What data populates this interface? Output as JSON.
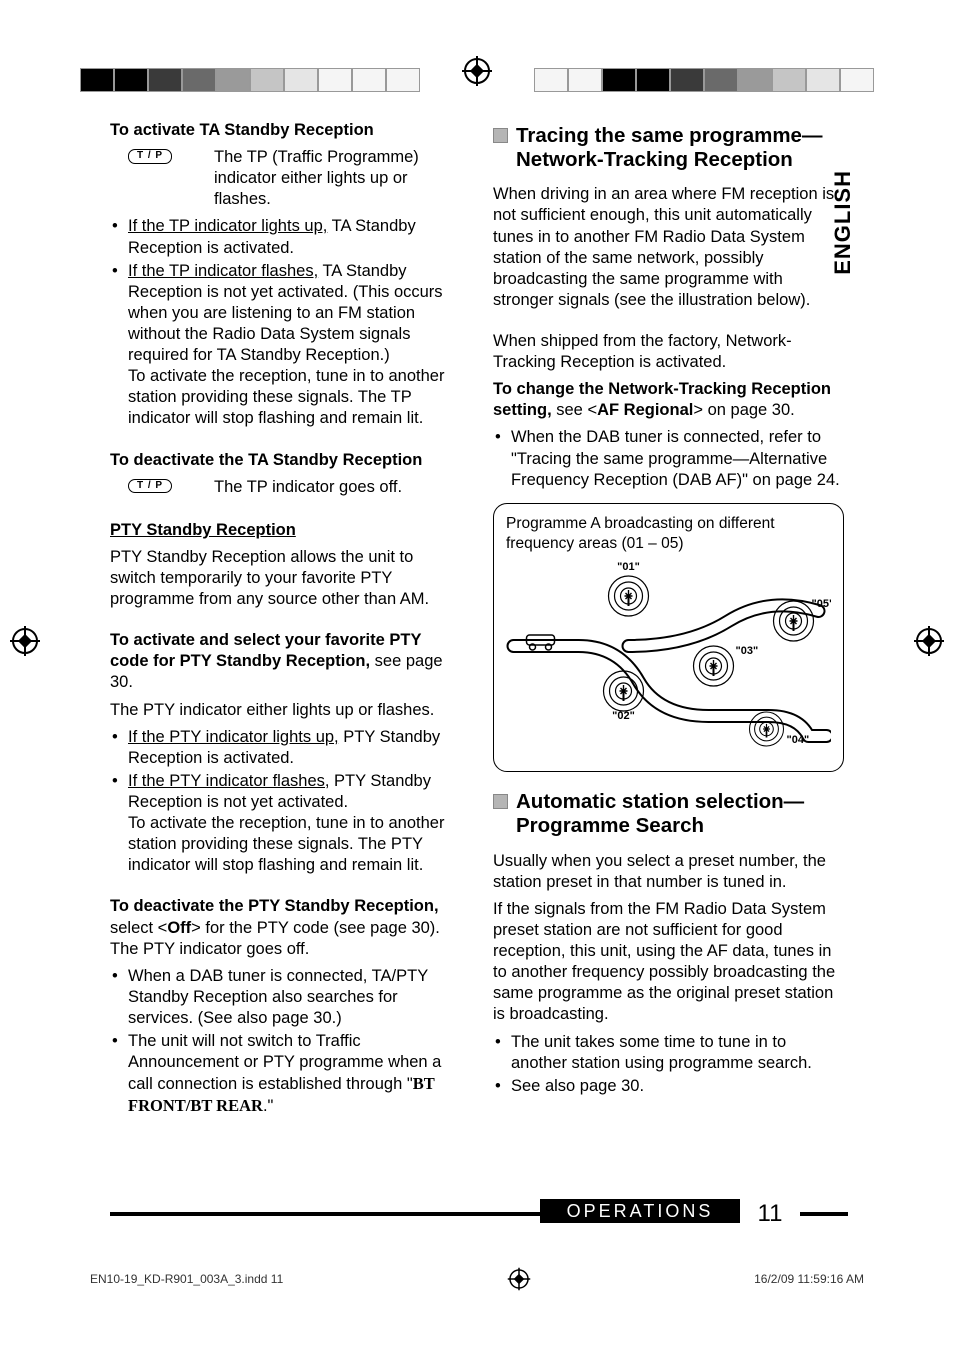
{
  "lang_tab": "ENGLISH",
  "left": {
    "h_activate_ta": "To activate TA Standby Reception",
    "tp_btn": "T / P",
    "tp_desc": "The TP (Traffic Programme) indicator either lights up or flashes.",
    "ta_b1_u": "If the TP indicator lights up,",
    "ta_b1_rest": " TA Standby Reception is activated.",
    "ta_b2_u": "If the TP indicator flashes,",
    "ta_b2_rest": " TA Standby Reception is not yet activated. (This occurs when you are listening to an FM station without the Radio Data System signals required for TA Standby Reception.)",
    "ta_b2_p2": "To activate the reception, tune in to another station providing these signals. The TP indicator will stop flashing and remain lit.",
    "h_deact_ta": "To deactivate the TA Standby Reception",
    "deact_ta_desc": "The TP indicator goes off.",
    "h_pty": "PTY Standby Reception",
    "pty_intro": "PTY Standby Reception allows the unit to switch temporarily to your favorite PTY programme from any source other than AM.",
    "h_act_pty_1": "To activate and select your favorite PTY code for PTY Standby Reception,",
    "h_act_pty_2": " see page 30.",
    "pty_flash": "The PTY indicator either lights up or flashes.",
    "pty_b1_u": "If the PTY indicator lights up,",
    "pty_b1_rest": " PTY Standby Reception is activated.",
    "pty_b2_u": "If the PTY indicator flashes,",
    "pty_b2_rest": " PTY Standby Reception is not yet activated.",
    "pty_b2_p2": "To activate the reception, tune in to another station providing these signals. The PTY indicator will stop flashing and remain lit.",
    "h_deact_pty": "To deactivate the PTY Standby Reception,",
    "deact_pty_rest1": " select <",
    "off_bold": "Off",
    "deact_pty_rest2": "> for the PTY code (see page 30). The PTY indicator goes off.",
    "deact_b1": "When a DAB tuner is connected, TA/PTY Standby Reception also searches for services. (See also page 30.)",
    "deact_b2_a": "The unit will not switch to Traffic Announcement or PTY programme when a call connection is established through \"",
    "bt_bold": "BT FRONT/BT REAR",
    "deact_b2_b": ".\""
  },
  "right": {
    "sec1_title": "Tracing the same programme—Network-Tracking Reception",
    "sec1_p1": "When driving in an area where FM reception is not sufficient enough, this unit automatically tunes in to another FM Radio Data System station of the same network, possibly broadcasting the same programme with stronger signals (see the illustration below).",
    "sec1_p2": "When shipped from the factory, Network-Tracking Reception is activated.",
    "sec1_h1": "To change the Network-Tracking Reception setting,",
    "sec1_h1_rest1": " see <",
    "af_bold": "AF Regional",
    "sec1_h1_rest2": "> on page 30.",
    "sec1_b1": "When the DAB tuner is connected, refer to \"Tracing the same programme—Alternative Frequency Reception (DAB AF)\" on page 24.",
    "diagram_caption": "Programme A broadcasting on different frequency areas (01 – 05)",
    "sec2_title": "Automatic station selection—Programme Search",
    "sec2_p1": "Usually when you select a preset number, the station preset in that number is tuned in.",
    "sec2_p2": "If the signals from the FM Radio Data System preset station are not sufficient for good reception, this unit, using the AF data, tunes in to another frequency possibly broadcasting the same programme as the original preset station is broadcasting.",
    "sec2_b1": "The unit takes some time to tune in to another station using programme search.",
    "sec2_b2": "See also page 30."
  },
  "footer": {
    "section": "OPERATIONS",
    "page": "11",
    "file": "EN10-19_KD-R901_003A_3.indd   11",
    "timestamp": "16/2/09   11:59:16 AM"
  }
}
